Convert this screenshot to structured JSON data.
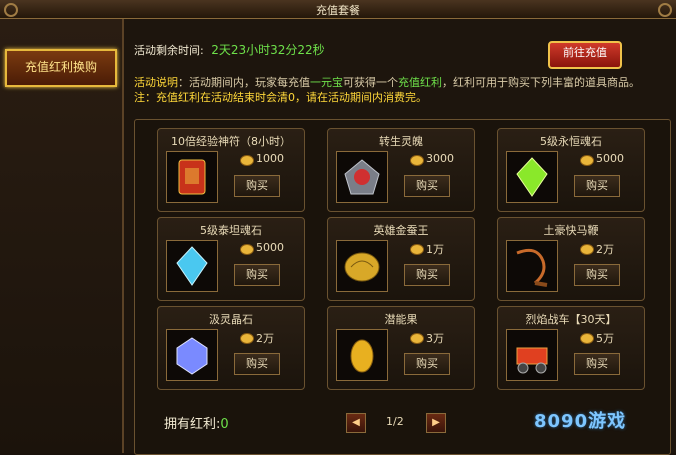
{
  "window": {
    "title": "充值套餐"
  },
  "sidebar": {
    "recharge_exchange_label": "充值红利换购"
  },
  "header": {
    "timer_label": "活动剩余时间:",
    "timer_value": "2天23小时32分22秒",
    "go_recharge_label": "前往充值"
  },
  "description": {
    "label": "活动说明",
    "p1": "：活动期间内，玩家每充值",
    "unit": "一元宝",
    "p2": "可获得一个",
    "bonus": "充值红利",
    "p3": "，红利可用于购买下列丰富的道具商品。",
    "note_label": "注：",
    "note": "充值红利在活动结束时会清0，请在活动期间内消费完。"
  },
  "items": [
    {
      "name": "10倍经验神符（8小时）",
      "price": "1000",
      "buy": "购买",
      "icon": "scroll-icon",
      "color": "#c8321a"
    },
    {
      "name": "转生灵魄",
      "price": "3000",
      "buy": "购买",
      "icon": "soul-gem-icon",
      "color": "#d03030"
    },
    {
      "name": "5级永恒魂石",
      "price": "5000",
      "buy": "购买",
      "icon": "green-crystal-icon",
      "color": "#8ae82a"
    },
    {
      "name": "5级泰坦魂石",
      "price": "5000",
      "buy": "购买",
      "icon": "blue-crystal-icon",
      "color": "#4ac8f0"
    },
    {
      "name": "英雄金蚕王",
      "price": "1万",
      "buy": "购买",
      "icon": "golden-silkworm-icon",
      "color": "#d8a828"
    },
    {
      "name": "土豪快马鞭",
      "price": "2万",
      "buy": "购买",
      "icon": "whip-icon",
      "color": "#c86a2a"
    },
    {
      "name": "汲灵晶石",
      "price": "2万",
      "buy": "购买",
      "icon": "spirit-crystal-icon",
      "color": "#7a8aff"
    },
    {
      "name": "潜能果",
      "price": "3万",
      "buy": "购买",
      "icon": "potential-fruit-icon",
      "color": "#e8b020"
    },
    {
      "name": "烈焰战车【30天】",
      "price": "5万",
      "buy": "购买",
      "icon": "flame-chariot-icon",
      "color": "#e04020"
    }
  ],
  "footer": {
    "owned_label": "拥有红利:",
    "owned_value": "0",
    "page": "1/2"
  },
  "watermark": {
    "text": "8090游戏"
  }
}
